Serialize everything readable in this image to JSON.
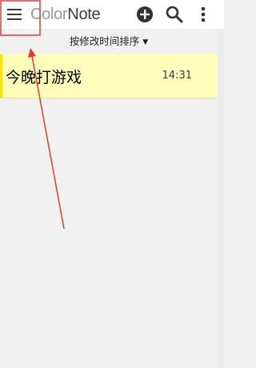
{
  "topbar": {
    "menu_icon": "hamburger-menu-icon",
    "title_prefix": "Color",
    "title_suffix": "Note",
    "add_icon": "plus-circle-icon",
    "search_icon": "search-icon",
    "more_icon": "more-vertical-icon"
  },
  "sort": {
    "label": "按修改时间排序",
    "caret": "▼"
  },
  "notes": [
    {
      "title": "今晚打游戏",
      "time": "14:31",
      "color": "#fffdb9",
      "accent": "#f4e60e"
    }
  ],
  "colors": {
    "background": "#f1f1f1",
    "highlight": "#e53935",
    "icon": "#3a3a3a"
  }
}
